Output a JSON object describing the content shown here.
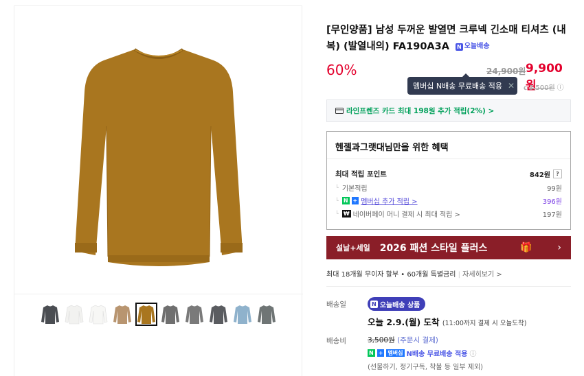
{
  "product": {
    "title": "[무인양품] 남성 두꺼운 발열면 크루넥 긴소매 티셔츠 (내복) (발열내의) FA190A3A",
    "today_badge_n": "N",
    "today_badge": "오늘배송",
    "discount": "60%",
    "original_price": "24,900원",
    "sale_price": "9,900원",
    "main_color": "#a9761f"
  },
  "tooltip": {
    "text": "멤버십 N배송 무료배송 적용",
    "close": "✕"
  },
  "shipping_small": {
    "icon": "truck-icon",
    "prefix": "ꞓ",
    "fee": "3,500원",
    "info": "ⓘ"
  },
  "card_bar": {
    "text": "라인프렌즈 카드 최대 198원 추가 적립(2%) >"
  },
  "benefit": {
    "title": "헨젤과그랫대님만을 위한 혜택",
    "rows": [
      {
        "label": "최대 적립 포인트",
        "value": "842원",
        "q": "?"
      },
      {
        "label": "기본적립",
        "value": "99원"
      },
      {
        "label_a": "N",
        "label_b": "+",
        "label": "멤버십 추가 적립 >",
        "value": "396원"
      },
      {
        "label_n": "₩",
        "label": "네이버페이 머니 결제 시 최대 적립 >",
        "value": "197원"
      }
    ]
  },
  "banner": {
    "tag": "설날+세일",
    "text": "2026 패션 스타일 플러스",
    "arrow": "›",
    "bg": "#8a1e28"
  },
  "installment": {
    "text": "최대 18개월 무이자 할부 • 60개월 특별금리",
    "more": "자세히보기 >"
  },
  "delivery": {
    "label": "배송일",
    "pill_n": "N",
    "pill_text": "오늘배송 상품",
    "arrive": "오늘 2.9.(월) 도착",
    "arrive_note": "(11:00까지 결제 시 오늘도착)"
  },
  "fee": {
    "label": "배송비",
    "amount": "3,500원",
    "paren": "(주문시 결제)",
    "n": "N",
    "plus": "+",
    "membership": "멤버십",
    "nship": "N배송 무료배송 적용",
    "info": "ⓘ",
    "exclusion": "(선물하기, 정기구독, 착불 등 일부 제외)"
  },
  "thumbnails": [
    {
      "name": "thumb-charcoal",
      "color": "#4a4d52"
    },
    {
      "name": "thumb-white-1",
      "color": "#f2f2f0"
    },
    {
      "name": "thumb-white-2",
      "color": "#f7f7f5"
    },
    {
      "name": "thumb-beige",
      "color": "#b89570"
    },
    {
      "name": "thumb-mustard",
      "color": "#a9761f"
    },
    {
      "name": "thumb-gray",
      "color": "#6f6f6f"
    },
    {
      "name": "thumb-gray-2",
      "color": "#7a7a7a"
    },
    {
      "name": "thumb-charcoal-2",
      "color": "#5a5c60"
    },
    {
      "name": "thumb-blue",
      "color": "#8fb2cc"
    },
    {
      "name": "thumb-slate",
      "color": "#6f7575"
    }
  ]
}
